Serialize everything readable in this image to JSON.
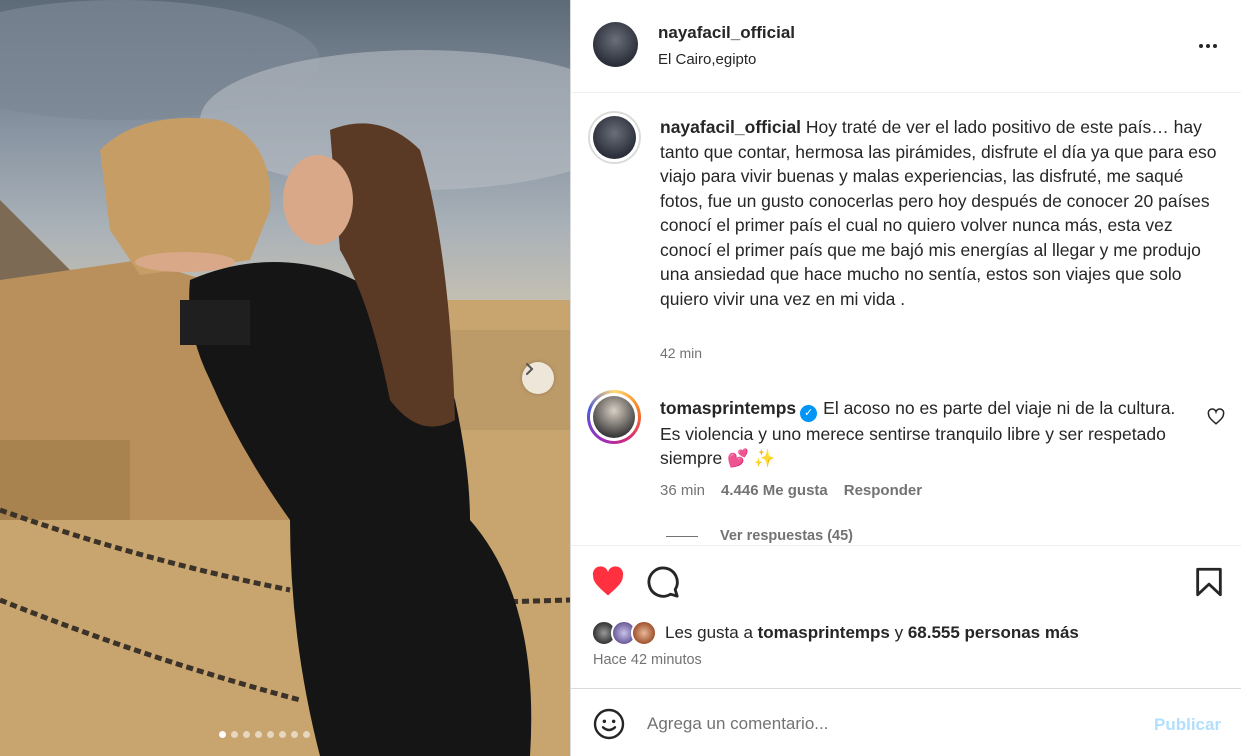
{
  "post": {
    "username": "nayafacil_official",
    "location": "El Cairo,egipto",
    "caption_user": "nayafacil_official",
    "caption_text": "Hoy traté de ver el lado positivo de este país… hay tanto que contar, hermosa las pirámides, disfrute el día ya que para eso viajo para vivir buenas y malas experiencias, las disfruté, me saqué fotos, fue un gusto conocerlas pero hoy después de conocer 20 países conocí el primer país el cual no quiero volver nunca más, esta vez conocí el primer país que me bajó mis energías al llegar y me produjo una ansiedad que hace mucho no sentía, estos son viajes que solo quiero vivir una vez en mi vida .",
    "caption_time": "42 min"
  },
  "comment": {
    "username": "tomasprintemps",
    "text": "El acoso no es parte del viaje ni de la cultura. Es violencia y uno merece sentirse tranquilo libre y ser respetado siempre 💕 ✨",
    "time": "36 min",
    "likes": "4.446 Me gusta",
    "reply_label": "Responder",
    "view_replies": "Ver respuestas (45)"
  },
  "likes": {
    "prefix": "Les gusta a ",
    "user": "tomasprintemps",
    "connector": " y ",
    "others": "68.555 personas más"
  },
  "posted_ago": "Hace 42 minutos",
  "add_comment": {
    "placeholder": "Agrega un comentario...",
    "publish_label": "Publicar"
  },
  "carousel": {
    "total_slides": 8,
    "active_slide": 1
  },
  "colors": {
    "like_red": "#ff3040",
    "verified_blue": "#0095f6",
    "publish_disabled": "#b2dffc",
    "muted_text": "#737373"
  }
}
